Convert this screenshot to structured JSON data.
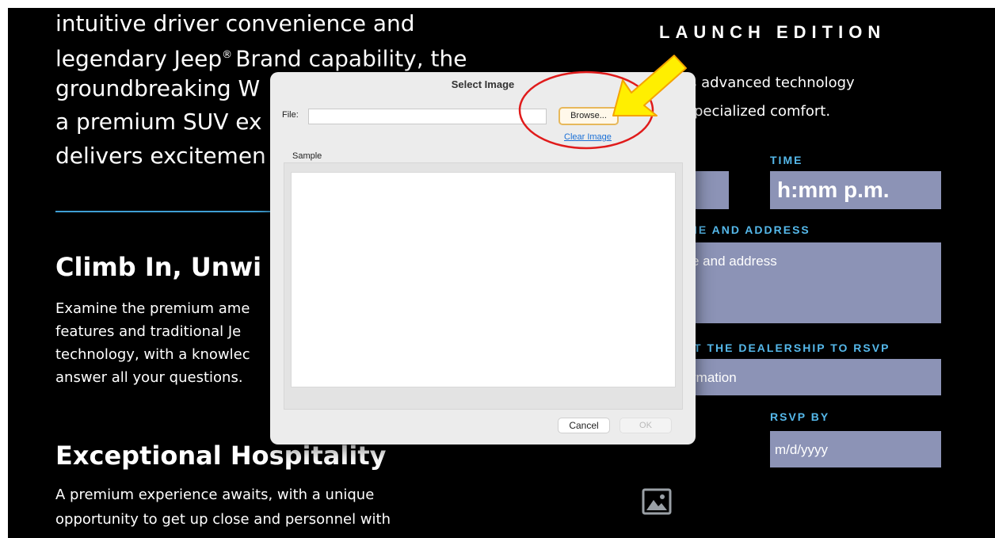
{
  "left": {
    "intro_lines": [
      "intuitive driver convenience and",
      "legendary Jeep",
      "® ",
      "Brand capability, the",
      "groundbreaking W",
      "a premium SUV ex",
      "delivers excitemen"
    ],
    "climb_heading": "Climb In, Unwi",
    "climb_body": [
      "Examine the premium ame",
      "features and traditional Je",
      "technology, with a knowlec",
      "answer all your questions."
    ],
    "hospitality_heading": "Exceptional Hospitality",
    "hospitality_body": [
      "A premium experience awaits, with a unique",
      "opportunity to get up close and personnel with"
    ]
  },
  "right": {
    "launch_title": "LAUNCH EDITION",
    "copy_line1": "s advanced technology",
    "copy_line2": "pecialized comfort.",
    "time_label": "TIME",
    "time_value": "h:mm p.m.",
    "address_label": "IE AND ADDRESS",
    "address_value": "e and address",
    "rsvp_contact_label": "T THE DEALERSHIP TO RSVP",
    "rsvp_contact_value": "rmation",
    "rsvp_by_label": "RSVP BY",
    "rsvp_by_value": "m/d/yyyy"
  },
  "dialog": {
    "title": "Select Image",
    "file_label": "File:",
    "file_value": "",
    "browse_label": "Browse...",
    "clear_label": "Clear Image",
    "sample_label": "Sample",
    "cancel_label": "Cancel",
    "ok_label": "OK"
  },
  "colors": {
    "page_bg": "#000000",
    "field_bg": "#8c93b6",
    "accent_blue": "#55b8ea",
    "divider_blue": "#3f9fd4",
    "annotation_red": "#e01b1b",
    "annotation_arrow": "#ffef00"
  },
  "icons": {
    "image": "image-icon",
    "arrow": "arrow-icon"
  }
}
